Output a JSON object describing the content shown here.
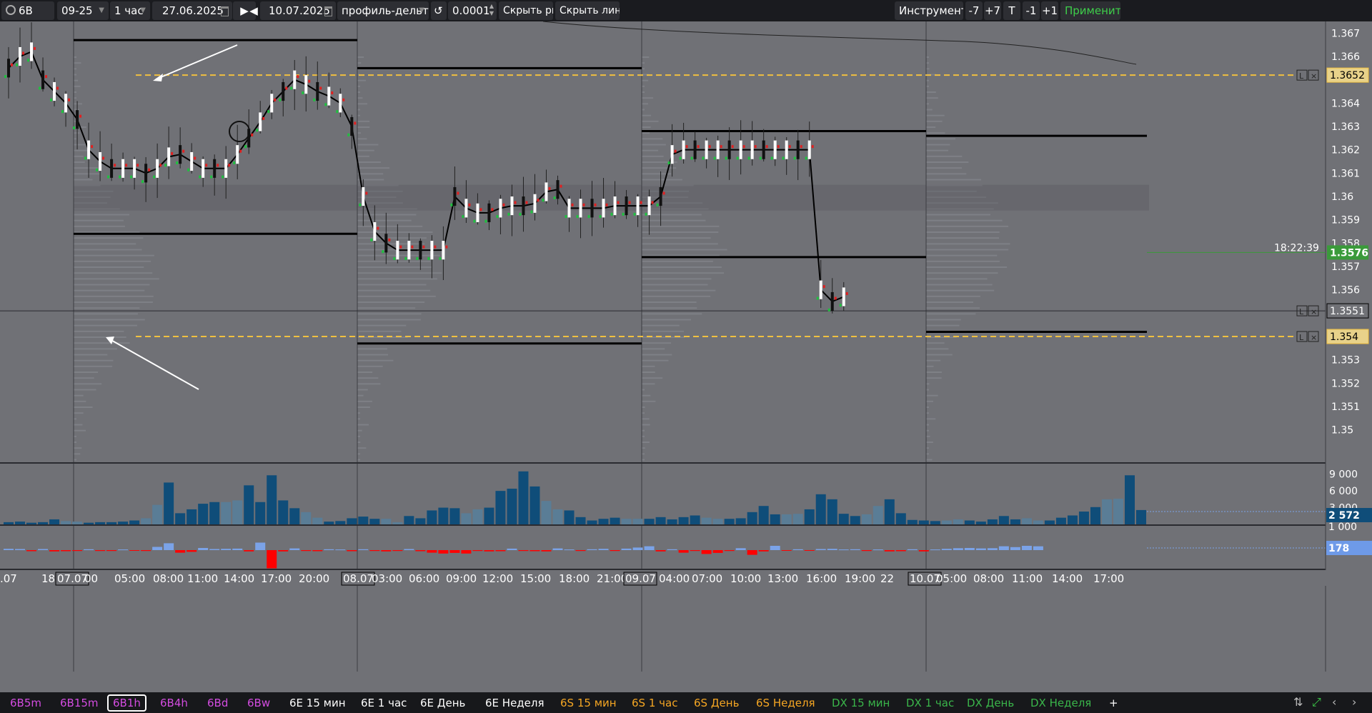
{
  "toolbar": {
    "symbol": "6B",
    "contract": "09-25",
    "timeframe": "1 час",
    "date_from": "27.06.2025",
    "date_to": "10.07.2025",
    "profile": "профиль-дельта",
    "tick": "0.0001",
    "hide_drawings": "Скрыть рис.",
    "hide_lines": "Скрыть линии",
    "tools": "Инструменты",
    "minus7": "-7",
    "plus7": "+7",
    "t": "T",
    "minus1": "-1",
    "plus1": "+1",
    "apply": "Применить"
  },
  "price_axis": {
    "ticks": [
      "1.367",
      "1.366",
      "1.3652",
      "1.364",
      "1.363",
      "1.362",
      "1.361",
      "1.36",
      "1.359",
      "1.358",
      "1.3576",
      "1.357",
      "1.356",
      "1.3551",
      "1.354",
      "1.353",
      "1.352",
      "1.351",
      "1.35"
    ],
    "current_price": "1.3576",
    "countdown": "18:22:39",
    "level_high": "1.3652",
    "level_cursor": "1.3551",
    "level_low": "1.354",
    "volume_ticks": [
      "9 000",
      "6 000",
      "3 000"
    ],
    "volume_current": "2 572",
    "delta_tick": "1 000",
    "delta_current": "178"
  },
  "time_axis": [
    ".07",
    "18",
    "07.07",
    "00",
    "05:00",
    "08:00",
    "11:00",
    "14:00",
    "17:00",
    "20:00",
    "08.07",
    "03:00",
    "06:00",
    "09:00",
    "12:00",
    "15:00",
    "18:00",
    "21:00",
    "09.07",
    "04:00",
    "07:00",
    "10:00",
    "13:00",
    "16:00",
    "19:00",
    "22",
    "10.07",
    "05:00",
    "08:00",
    "11:00",
    "14:00",
    "17:00"
  ],
  "bottom_tabs": [
    {
      "label": "6B5m",
      "color": "pink"
    },
    {
      "label": "6B15m",
      "color": "pink"
    },
    {
      "label": "6B1h",
      "color": "pink",
      "active": true
    },
    {
      "label": "6B4h",
      "color": "pink"
    },
    {
      "label": "6Bd",
      "color": "pink"
    },
    {
      "label": "6Bw",
      "color": "pink"
    },
    {
      "label": "6E 15 мин",
      "color": "white"
    },
    {
      "label": "6E 1 час",
      "color": "white"
    },
    {
      "label": "6E День",
      "color": "white"
    },
    {
      "label": "6E Неделя",
      "color": "white"
    },
    {
      "label": "6S 15 мин",
      "color": "orange"
    },
    {
      "label": "6S 1 час",
      "color": "orange"
    },
    {
      "label": "6S День",
      "color": "orange"
    },
    {
      "label": "6S Неделя",
      "color": "orange"
    },
    {
      "label": "DX 15 мин",
      "color": "green"
    },
    {
      "label": "DX 1 час",
      "color": "green"
    },
    {
      "label": "DX День",
      "color": "green"
    },
    {
      "label": "DX Неделя",
      "color": "green"
    }
  ],
  "add_tab": "+",
  "colors": {
    "background": "#707176",
    "toolbar": "#1a1b1f",
    "volume_bar": "#0f4d79",
    "volume_bar_light": "#5a7d96",
    "delta_pos": "#7ba3e8",
    "delta_neg": "#ff0000",
    "level_line": "#f0c040",
    "current_price_bg": "#3a9a3a"
  },
  "chart_data": {
    "type": "candlestick-footprint",
    "instrument": "6B 09-25",
    "timeframe": "1 час",
    "y_range": [
      1.3495,
      1.3675
    ],
    "day_separators": [
      "07.07",
      "08.07",
      "09.07",
      "10.07"
    ],
    "levels": [
      1.3652,
      1.354
    ],
    "close_path": [
      [
        0,
        1.3655
      ],
      [
        1,
        1.366
      ],
      [
        2,
        1.3662
      ],
      [
        3,
        1.365
      ],
      [
        4,
        1.3645
      ],
      [
        5,
        1.364
      ],
      [
        6,
        1.3633
      ],
      [
        7,
        1.362
      ],
      [
        8,
        1.3615
      ],
      [
        9,
        1.3612
      ],
      [
        10,
        1.3612
      ],
      [
        11,
        1.3612
      ],
      [
        12,
        1.361
      ],
      [
        13,
        1.3612
      ],
      [
        14,
        1.3617
      ],
      [
        15,
        1.3618
      ],
      [
        16,
        1.3615
      ],
      [
        17,
        1.3612
      ],
      [
        18,
        1.3612
      ],
      [
        19,
        1.3612
      ],
      [
        20,
        1.3618
      ],
      [
        21,
        1.3625
      ],
      [
        22,
        1.3632
      ],
      [
        23,
        1.364
      ],
      [
        24,
        1.3645
      ],
      [
        25,
        1.365
      ],
      [
        26,
        1.3648
      ],
      [
        27,
        1.3645
      ],
      [
        28,
        1.3643
      ],
      [
        29,
        1.364
      ],
      [
        30,
        1.363
      ],
      [
        31,
        1.36
      ],
      [
        32,
        1.3585
      ],
      [
        33,
        1.358
      ],
      [
        34,
        1.3577
      ],
      [
        35,
        1.3577
      ],
      [
        36,
        1.3577
      ],
      [
        37,
        1.3577
      ],
      [
        38,
        1.3577
      ],
      [
        39,
        1.36
      ],
      [
        40,
        1.3595
      ],
      [
        41,
        1.3593
      ],
      [
        42,
        1.3593
      ],
      [
        43,
        1.3595
      ],
      [
        44,
        1.3596
      ],
      [
        45,
        1.3596
      ],
      [
        46,
        1.3597
      ],
      [
        47,
        1.3602
      ],
      [
        48,
        1.3603
      ],
      [
        49,
        1.3595
      ],
      [
        50,
        1.3595
      ],
      [
        51,
        1.3595
      ],
      [
        52,
        1.3595
      ],
      [
        53,
        1.3596
      ],
      [
        54,
        1.3596
      ],
      [
        55,
        1.3596
      ],
      [
        56,
        1.3596
      ],
      [
        57,
        1.36
      ],
      [
        58,
        1.3618
      ],
      [
        59,
        1.362
      ],
      [
        60,
        1.362
      ],
      [
        61,
        1.362
      ],
      [
        62,
        1.362
      ],
      [
        63,
        1.362
      ],
      [
        64,
        1.362
      ],
      [
        65,
        1.362
      ],
      [
        66,
        1.362
      ],
      [
        67,
        1.362
      ],
      [
        68,
        1.362
      ],
      [
        69,
        1.362
      ],
      [
        70,
        1.362
      ],
      [
        71,
        1.356
      ],
      [
        72,
        1.3555
      ],
      [
        73,
        1.3557
      ]
    ],
    "volume": [
      400,
      500,
      300,
      400,
      900,
      600,
      500,
      300,
      400,
      400,
      500,
      700,
      1100,
      3500,
      7500,
      2000,
      2700,
      3700,
      4000,
      4000,
      4300,
      7000,
      4000,
      8800,
      4300,
      2900,
      2200,
      1200,
      500,
      600,
      1100,
      1400,
      1000,
      1000,
      400,
      1500,
      1100,
      2500,
      3000,
      2900,
      2000,
      2700,
      3000,
      6000,
      6400,
      9500,
      6800,
      4200,
      2700,
      2500,
      1300,
      700,
      1000,
      1200,
      1000,
      1000,
      1000,
      1300,
      900,
      1300,
      1600,
      1200,
      1000,
      1000,
      1100,
      2200,
      3300,
      1800,
      1800,
      1900,
      2700,
      5400,
      4500,
      1900,
      1500,
      1800,
      3300,
      4500,
      2000,
      800,
      700,
      600,
      700,
      900,
      700,
      500,
      900,
      1500,
      900,
      1100,
      700,
      700,
      1200,
      1600,
      2300,
      3100,
      4500,
      4600,
      8800,
      2572
    ],
    "delta": [
      60,
      50,
      -50,
      50,
      -60,
      -50,
      -40,
      40,
      -40,
      -40,
      30,
      -30,
      -40,
      150,
      320,
      -120,
      -80,
      100,
      50,
      60,
      70,
      -60,
      350,
      -850,
      -60,
      80,
      -40,
      -50,
      40,
      30,
      -50,
      40,
      -40,
      -60,
      -40,
      50,
      -50,
      -120,
      -160,
      -130,
      -160,
      -40,
      -60,
      -50,
      70,
      -40,
      -50,
      -60,
      80,
      30,
      -40,
      40,
      60,
      -40,
      70,
      120,
      180,
      -60,
      40,
      -120,
      -40,
      -180,
      -130,
      -40,
      90,
      -220,
      -60,
      200,
      -20,
      40,
      -30,
      50,
      60,
      30,
      40,
      -40,
      30,
      -60,
      -50,
      40,
      -60,
      30,
      60,
      90,
      100,
      80,
      90,
      180,
      140,
      200,
      178
    ]
  }
}
